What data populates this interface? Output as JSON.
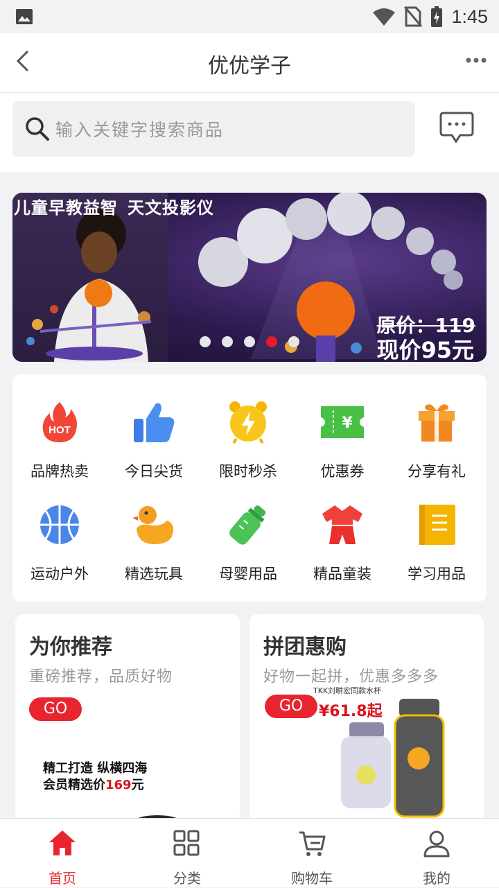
{
  "status_bar": {
    "time": "1:45"
  },
  "header": {
    "title": "优优学子"
  },
  "search": {
    "placeholder": "输入关键字搜索商品"
  },
  "banner": {
    "headline_left": "儿童早教益智",
    "headline_right": "天文投影仪",
    "original_price": "原价：119",
    "current_price": "现价95元",
    "dot_count": 5,
    "active_dot": 3
  },
  "categories": [
    {
      "label": "品牌热卖",
      "icon": "hot-icon"
    },
    {
      "label": "今日尖货",
      "icon": "thumbs-up-icon"
    },
    {
      "label": "限时秒杀",
      "icon": "alarm-clock-icon"
    },
    {
      "label": "优惠券",
      "icon": "coupon-icon"
    },
    {
      "label": "分享有礼",
      "icon": "gift-icon"
    },
    {
      "label": "运动户外",
      "icon": "basketball-icon"
    },
    {
      "label": "精选玩具",
      "icon": "duck-icon"
    },
    {
      "label": "母婴用品",
      "icon": "baby-bottle-icon"
    },
    {
      "label": "精品童装",
      "icon": "kids-clothes-icon"
    },
    {
      "label": "学习用品",
      "icon": "notebook-icon"
    }
  ],
  "cards": {
    "recommend": {
      "title": "为你推荐",
      "subtitle": "重磅推荐，品质好物",
      "go": "GO",
      "promo_line1": "精工打造 纵横四海",
      "promo_line2_prefix": "会员精选价",
      "promo_price": "169",
      "promo_unit": "元"
    },
    "group_buy": {
      "title": "拼团惠购",
      "subtitle": "好物一起拼，优惠多多多",
      "go": "GO",
      "product_caption": "TKK刘畊宏同款水杯",
      "product_price": "¥61.8起"
    }
  },
  "bottom_nav": [
    {
      "label": "首页",
      "icon": "home-icon",
      "active": true
    },
    {
      "label": "分类",
      "icon": "grid-icon",
      "active": false
    },
    {
      "label": "购物车",
      "icon": "cart-icon",
      "active": false
    },
    {
      "label": "我的",
      "icon": "user-icon",
      "active": false
    }
  ],
  "colors": {
    "accent": "#e8252f",
    "dot_active": "#e8192c"
  }
}
